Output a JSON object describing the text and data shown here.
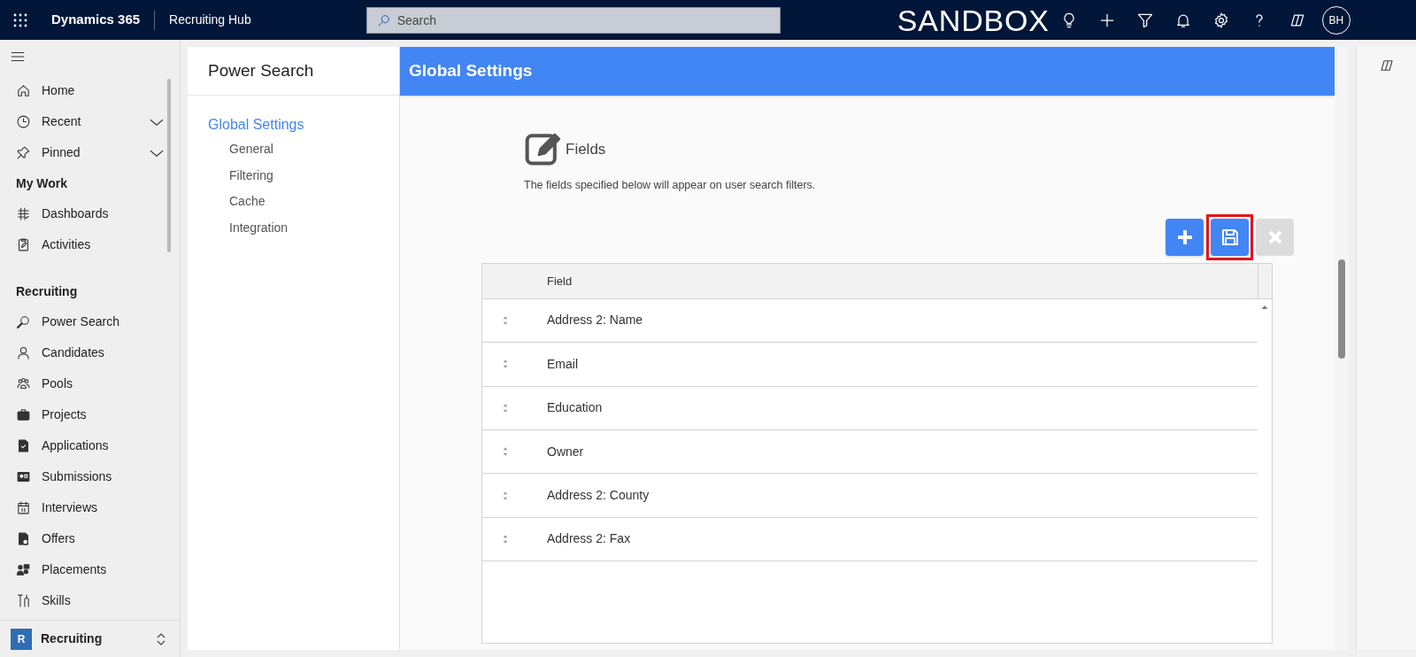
{
  "top_bar": {
    "app": "Dynamics 365",
    "area": "Recruiting Hub",
    "search_placeholder": "Search",
    "environment": "SANDBOX",
    "icons": [
      {
        "kind": "lightbulb"
      },
      {
        "kind": "plus"
      },
      {
        "kind": "filter"
      },
      {
        "kind": "bell"
      },
      {
        "kind": "settings"
      },
      {
        "kind": "help"
      },
      {
        "kind": "copilot"
      }
    ],
    "avatar": "BH"
  },
  "sidebar": {
    "items": [
      {
        "kind": "item",
        "label": "Home",
        "expandable": false
      },
      {
        "kind": "item",
        "label": "Recent",
        "expandable": true
      },
      {
        "kind": "item",
        "label": "Pinned",
        "expandable": true
      },
      {
        "kind": "heading",
        "label": "My Work"
      },
      {
        "kind": "item",
        "label": "Dashboards",
        "expandable": false
      },
      {
        "kind": "item",
        "label": "Activities",
        "expandable": false
      },
      {
        "kind": "heading",
        "label": "Recruiting"
      },
      {
        "kind": "item",
        "label": "Power Search",
        "expandable": false
      },
      {
        "kind": "item",
        "label": "Candidates",
        "expandable": false
      },
      {
        "kind": "item",
        "label": "Pools",
        "expandable": false
      },
      {
        "kind": "item",
        "label": "Projects",
        "expandable": false
      },
      {
        "kind": "item",
        "label": "Applications",
        "expandable": false
      },
      {
        "kind": "item",
        "label": "Submissions",
        "expandable": false
      },
      {
        "kind": "item",
        "label": "Interviews",
        "expandable": false
      },
      {
        "kind": "item",
        "label": "Offers",
        "expandable": false
      },
      {
        "kind": "item",
        "label": "Placements",
        "expandable": false
      },
      {
        "kind": "item",
        "label": "Skills",
        "expandable": false
      }
    ],
    "area_switcher": {
      "badge": "R",
      "label": "Recruiting"
    }
  },
  "settings_nav": {
    "title": "Power Search",
    "items": [
      {
        "label": "Global Settings",
        "selected": true,
        "children": [
          {
            "label": "General",
            "selected": false
          },
          {
            "label": "Filtering",
            "selected": false
          },
          {
            "label": "Cache",
            "selected": false
          },
          {
            "label": "Integration",
            "selected": false
          }
        ]
      }
    ]
  },
  "page": {
    "header": "Global Settings",
    "section_title": "Fields",
    "description": "The fields specified below will appear on user search filters.",
    "buttons": [
      {
        "kind": "add",
        "disabled": false,
        "highlighted": false
      },
      {
        "kind": "save",
        "disabled": false,
        "highlighted": true
      },
      {
        "kind": "delete",
        "disabled": true,
        "highlighted": false
      }
    ],
    "table": {
      "columns": [
        "Field"
      ],
      "rows": [
        "Address 2: Name",
        "Email",
        "Education",
        "Owner",
        "Address 2: County",
        "Address 2: Fax"
      ]
    }
  }
}
